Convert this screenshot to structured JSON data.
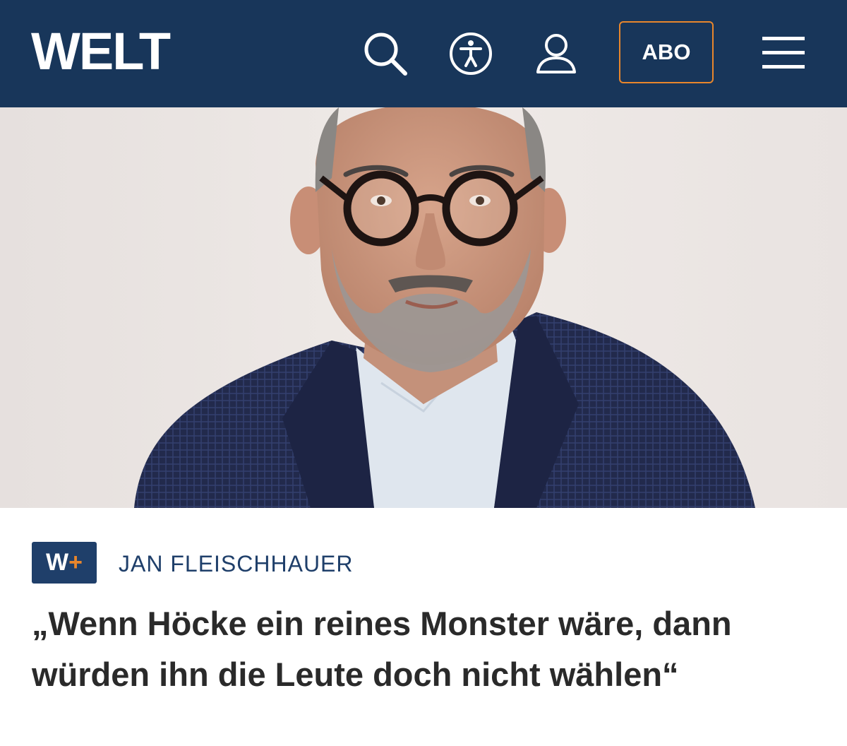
{
  "header": {
    "logo_text": "WELT",
    "search_icon": "search-icon",
    "accessibility_icon": "accessibility-icon",
    "account_icon": "user-icon",
    "abo_label": "ABO",
    "menu_icon": "hamburger-menu-icon",
    "background_color": "#18365a",
    "accent_color": "#e8862c"
  },
  "hero": {
    "image": "portrait-photo"
  },
  "article": {
    "badge_w": "W",
    "badge_plus": "+",
    "author": "JAN FLEISCHHAUER",
    "headline": "„Wenn Höcke ein reines Monster wäre, dann würden ihn die Leute doch nicht wählen“"
  }
}
